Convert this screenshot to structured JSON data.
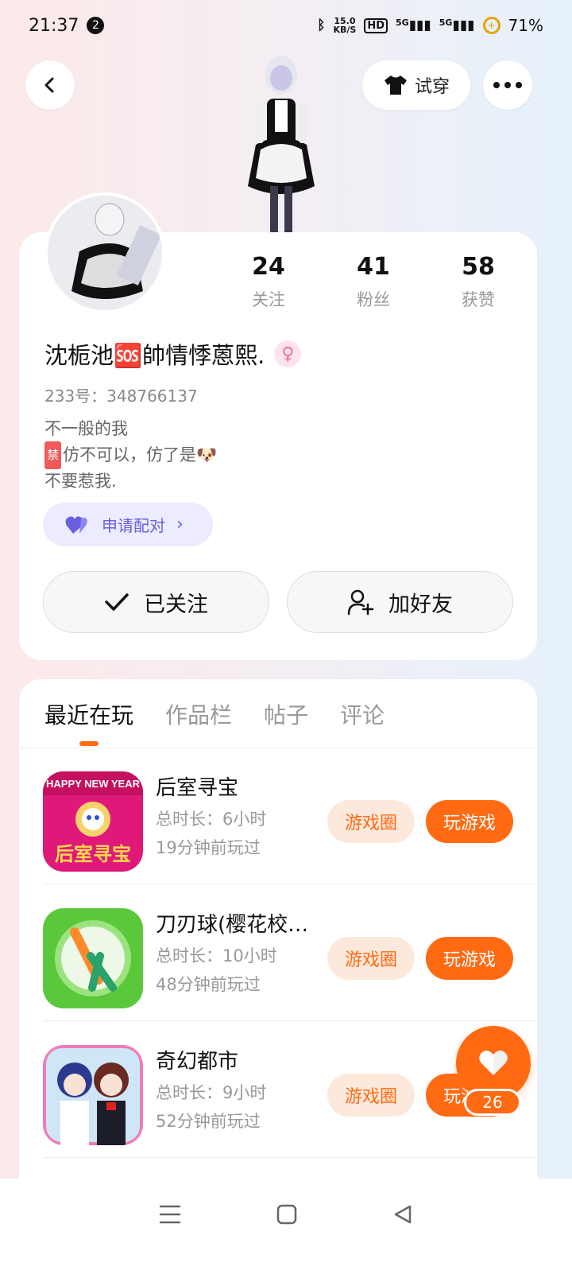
{
  "status_bar": {
    "time": "21:37",
    "notification_count": "2",
    "net_speed_value": "15.0",
    "net_speed_unit": "KB/S",
    "hd_label": "HD",
    "signal1": "5G",
    "signal2": "5G",
    "battery": "71%"
  },
  "header": {
    "tryon_label": "试穿"
  },
  "profile": {
    "stats": [
      {
        "value": "24",
        "label": "关注"
      },
      {
        "value": "41",
        "label": "粉丝"
      },
      {
        "value": "58",
        "label": "获赞"
      }
    ],
    "nickname": "沈栀池🆘帥情悸蒽熙.",
    "uid": "233号：348766137",
    "bio": {
      "line1": "不一般的我",
      "line2_tag": "禁",
      "line2_text": "仿不可以，仿了是🐶",
      "line3": "不要惹我."
    },
    "pair_label": "申请配对",
    "follow_label": "已关注",
    "add_friend_label": "加好友"
  },
  "tabs": [
    "最近在玩",
    "作品栏",
    "帖子",
    "评论"
  ],
  "games": [
    {
      "title": "后室寻宝",
      "duration": "总时长：6小时",
      "last_played": "19分钟前玩过",
      "circle_label": "游戏圈",
      "play_label": "玩游戏"
    },
    {
      "title": "刀刃球(樱花校…",
      "duration": "总时长：10小时",
      "last_played": "48分钟前玩过",
      "circle_label": "游戏圈",
      "play_label": "玩游戏"
    },
    {
      "title": "奇幻都市",
      "duration": "总时长：9小时",
      "last_played": "52分钟前玩过",
      "circle_label": "游戏圈",
      "play_label": "玩游戏"
    }
  ],
  "game_icon_text": {
    "banner": "HAPPY NEW YEAR",
    "logo": "后室寻宝"
  },
  "like": {
    "count": "26"
  },
  "colors": {
    "accent": "#ff6a13",
    "pair_purple": "#6a5fe0",
    "gender_pink": "#f06b9a"
  },
  "icons": {
    "back": "back-arrow-icon",
    "tryon": "tshirt-icon",
    "more": "more-dots-icon",
    "follow": "check-icon",
    "add_friend": "add-person-icon",
    "pair": "heart-pair-icon",
    "like": "heart-icon"
  }
}
